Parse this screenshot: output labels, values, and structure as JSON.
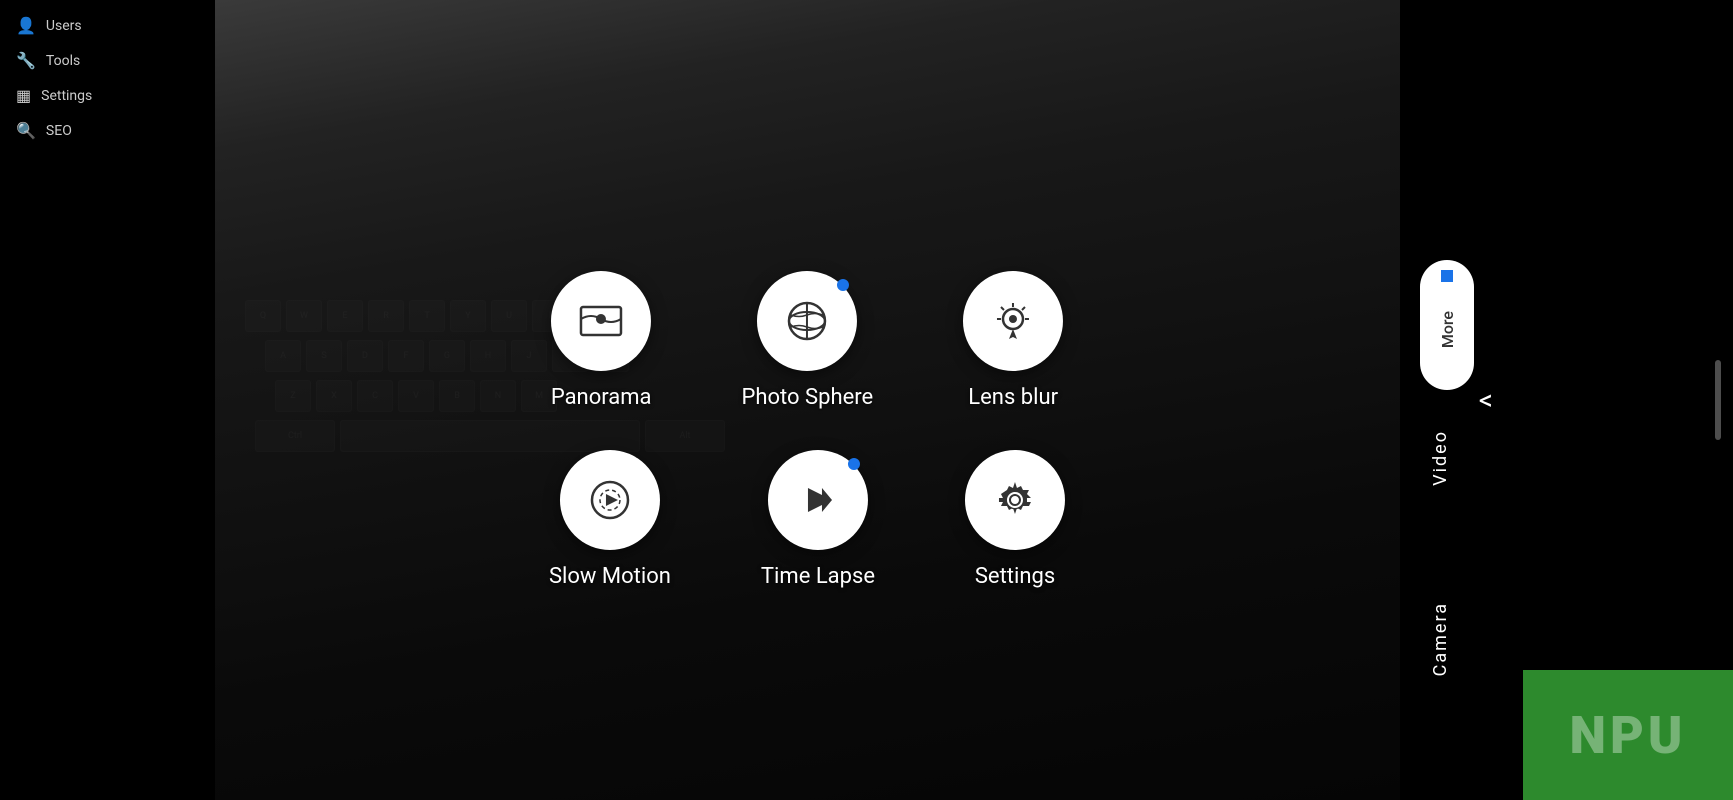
{
  "sidebar": {
    "items": [
      {
        "id": "users",
        "label": "Users",
        "icon": "👤"
      },
      {
        "id": "tools",
        "label": "Tools",
        "icon": "🔧"
      },
      {
        "id": "settings",
        "label": "Settings",
        "icon": "▦"
      },
      {
        "id": "seo",
        "label": "SEO",
        "icon": "🔍"
      }
    ]
  },
  "camera": {
    "modes_row1": [
      {
        "id": "panorama",
        "label": "Panorama",
        "has_dot": false
      },
      {
        "id": "photo_sphere",
        "label": "Photo Sphere",
        "has_dot": true
      },
      {
        "id": "lens_blur",
        "label": "Lens blur",
        "has_dot": false
      }
    ],
    "modes_row2": [
      {
        "id": "slow_motion",
        "label": "Slow Motion",
        "has_dot": false
      },
      {
        "id": "time_lapse",
        "label": "Time Lapse",
        "has_dot": true
      },
      {
        "id": "settings_mode",
        "label": "Settings",
        "has_dot": false
      }
    ]
  },
  "right_panel": {
    "more_label": "More",
    "video_label": "Video",
    "camera_label": "Camera",
    "back_arrow": "<",
    "npu_text": "NPU",
    "scroll_up_dot_color": "#1a73e8"
  }
}
